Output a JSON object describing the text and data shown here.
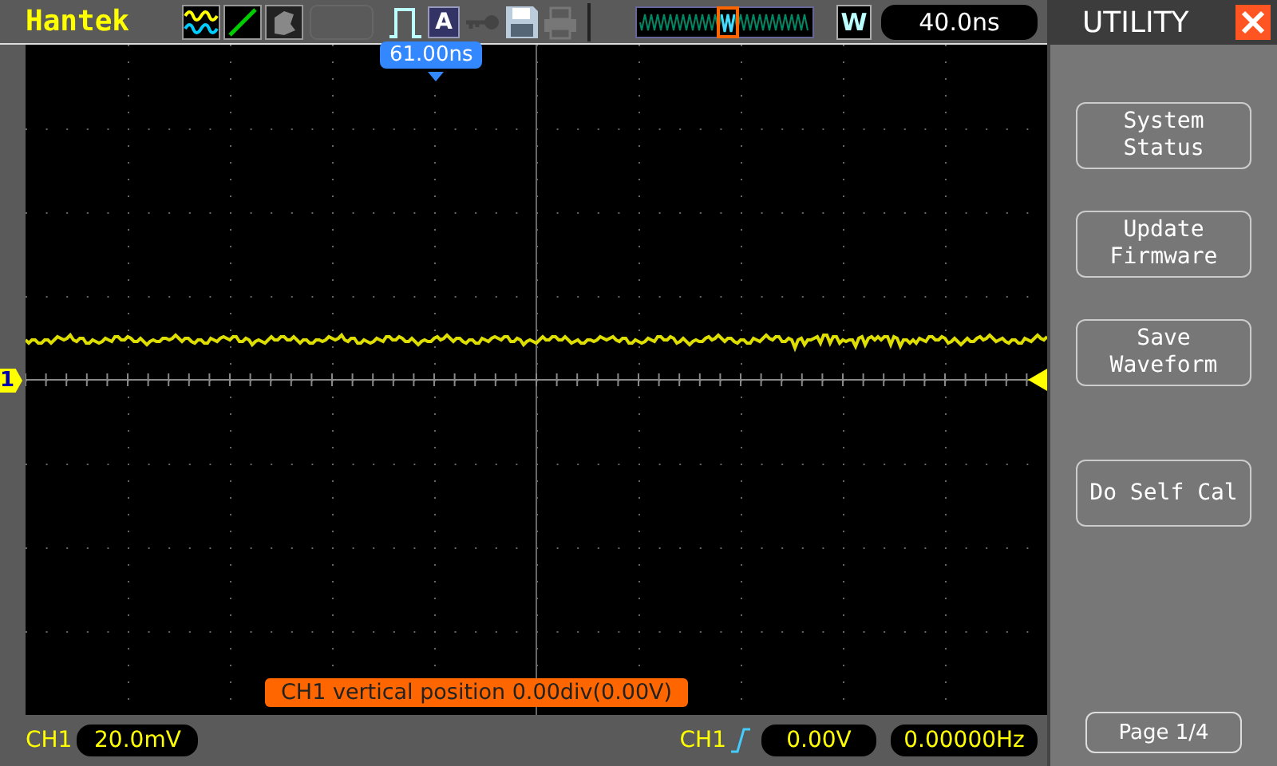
{
  "top_bar": {
    "brand": "Hantek",
    "trigger_mode": "A",
    "timebase_label": "W",
    "timebase": "40.0ns"
  },
  "screen": {
    "cursor_readout": "61.00ns",
    "channel_marker": "1",
    "status_message": "CH1 vertical position 0.00div(0.00V)"
  },
  "menu": {
    "title": "UTILITY",
    "buttons": [
      {
        "label": "System\nStatus"
      },
      {
        "label": "Update\nFirmware"
      },
      {
        "label": "Save\nWaveform"
      },
      {
        "label": "Do Self Cal"
      }
    ],
    "page": "Page 1/4"
  },
  "status_bar": {
    "channel": "CH1",
    "volts_per_div": "20.0mV",
    "trigger_channel": "CH1",
    "trigger_level": "0.00V",
    "frequency": "0.00000Hz"
  }
}
